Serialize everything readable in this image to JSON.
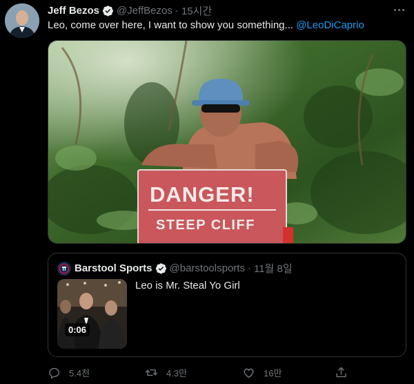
{
  "tweet": {
    "display_name": "Jeff Bezos",
    "handle": "@JeffBezos",
    "separator": "·",
    "time": "15시간",
    "text_prefix": "Leo, come over here, I want to show you something... ",
    "mention": "@LeoDiCaprio",
    "photo": {
      "sign_line1": "DANGER!",
      "sign_line2": "STEEP CLIFF"
    }
  },
  "quote": {
    "display_name": "Barstool Sports",
    "handle": "@barstoolsports",
    "separator": "·",
    "time": "11월 8일",
    "text": "Leo is Mr. Steal Yo Girl",
    "video_duration": "0:06"
  },
  "actions": {
    "reply_count": "5.4천",
    "retweet_count": "4.3만",
    "like_count": "16만"
  },
  "colors": {
    "accent": "#1d9bf0",
    "muted": "#71767b",
    "background": "#000000",
    "border": "#2f3336"
  }
}
